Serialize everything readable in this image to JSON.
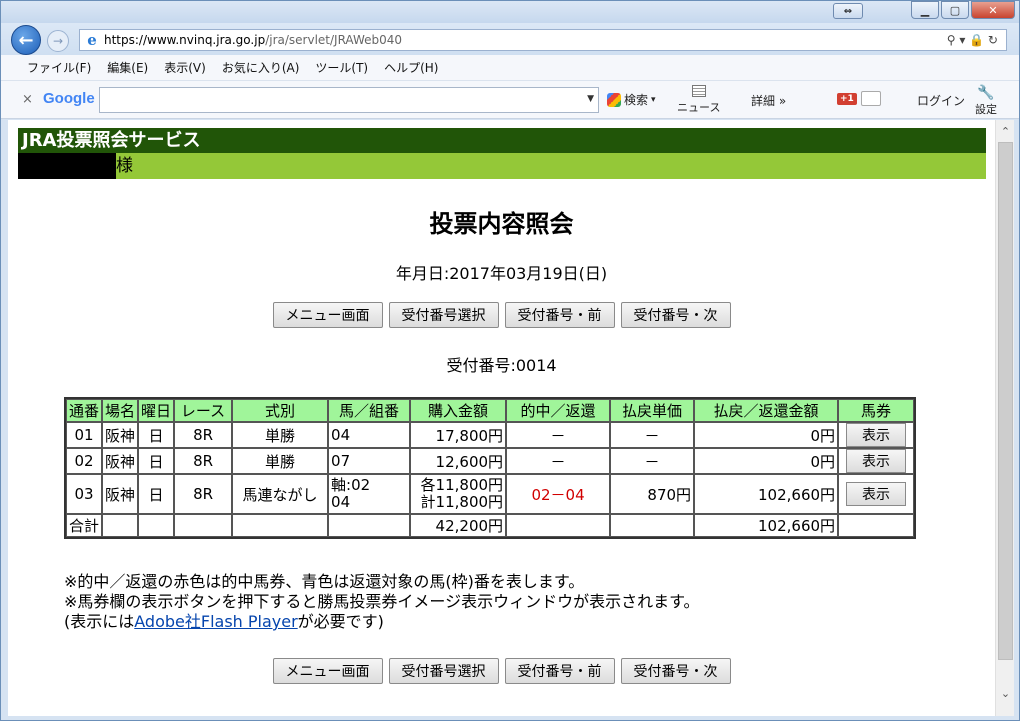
{
  "browser": {
    "url_host": "https://www.nvinq.jra.go.jp",
    "url_path": "/jra/servlet/JRAWeb040",
    "url_tools": "⚲ ▾ 🔒 ↻",
    "menu": [
      "ファイル(F)",
      "編集(E)",
      "表示(V)",
      "お気に入り(A)",
      "ツール(T)",
      "ヘルプ(H)"
    ],
    "google": {
      "close": "×",
      "logo": "Google",
      "search_label": "検索",
      "news_label": "ニュース",
      "detail_label": "詳細 »",
      "plus_label": "+1",
      "login_label": "ログイン",
      "settings_label": "設定"
    }
  },
  "page": {
    "service_title": "JRA投票照会サービス",
    "user_suffix": "様",
    "title": "投票内容照会",
    "date_line": "年月日:2017年03月19日(日)",
    "receipt_line": "受付番号:0014",
    "buttons": [
      "メニュー画面",
      "受付番号選択",
      "受付番号・前",
      "受付番号・次"
    ],
    "table": {
      "headers": [
        "通番",
        "場名",
        "曜日",
        "レース",
        "式別",
        "馬／組番",
        "購入金額",
        "的中／返還",
        "払戻単価",
        "払戻／返還金額",
        "馬券"
      ],
      "rows": [
        {
          "no": "01",
          "venue": "阪神",
          "day": "日",
          "race": "8R",
          "type": "単勝",
          "combo": [
            "04"
          ],
          "amount": [
            "17,800円"
          ],
          "hit": "－",
          "unit": "－",
          "payout": "0円",
          "ticket": "表示"
        },
        {
          "no": "02",
          "venue": "阪神",
          "day": "日",
          "race": "8R",
          "type": "単勝",
          "combo": [
            "07"
          ],
          "amount": [
            "12,600円"
          ],
          "hit": "－",
          "unit": "－",
          "payout": "0円",
          "ticket": "表示"
        },
        {
          "no": "03",
          "venue": "阪神",
          "day": "日",
          "race": "8R",
          "type": "馬連ながし",
          "combo": [
            "軸:02",
            "04"
          ],
          "amount": [
            "各11,800円",
            "計11,800円"
          ],
          "hit": "02－04",
          "unit": "870円",
          "payout": "102,660円",
          "ticket": "表示"
        }
      ],
      "total": {
        "label": "合計",
        "amount": "42,200円",
        "payout": "102,660円"
      }
    },
    "notes": {
      "line1": "※的中／返還の赤色は的中馬券、青色は返還対象の馬(枠)番を表します。",
      "line2": "※馬券欄の表示ボタンを押下すると勝馬投票券イメージ表示ウィンドウが表示されます。",
      "line3_prefix": "(表示には",
      "line3_link": "Adobe社Flash Player",
      "line3_suffix": "が必要です)"
    }
  },
  "colors": {
    "header_bg": "#215508",
    "user_bg": "#94c838",
    "table_header_bg": "#a0f59a",
    "hit_text": "#d10000"
  }
}
